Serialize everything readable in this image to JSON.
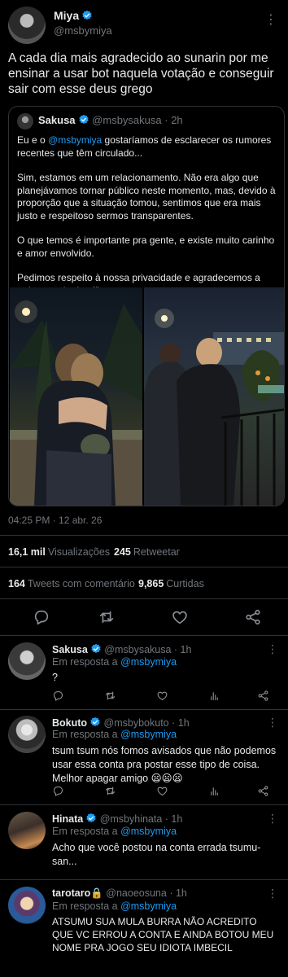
{
  "main": {
    "name": "Miya",
    "handle": "@msbymiya",
    "text": "A cada dia mais agradecido ao sunarin por me ensinar a usar bot naquela votação e conseguir sair com esse deus grego",
    "more_icon": "more-icon",
    "quote": {
      "name": "Sakusa",
      "handle": "@msbysakusa",
      "time": "· 2h",
      "p1_pre": "Eu e o ",
      "p1_mention": "@msbymiya",
      "p1_post": " gostaríamos de esclarecer os rumores recentes que têm circulado...",
      "p2": "Sim, estamos em um relacionamento. Não era algo que planejávamos tornar público neste momento, mas, devido à proporção que a situação tomou, sentimos que era mais justo e respeitoso sermos transparentes.",
      "p3": "O que temos é importante pra gente, e existe muito carinho e amor envolvido.",
      "p4": "Pedimos respeito à nossa privacidade e agradecemos a todo o apoio dos fãs."
    },
    "timestamp": "04:25 PM · 12 abr. 26",
    "views_count": "16,1 mil",
    "views_label": "Visualizações",
    "retweets_count": "245",
    "retweets_label": "Retweetar",
    "comments_count": "164",
    "comments_label": "Tweets com comentário",
    "likes_count": "9,865",
    "likes_label": "Curtidas"
  },
  "replies": [
    {
      "name": "Sakusa",
      "handle": "@msbysakusa",
      "time": "· 1h",
      "reply_to_label": "Em resposta a",
      "reply_to": "@msbymiya",
      "text": "?"
    },
    {
      "name": "Bokuto",
      "handle": "@msbybokuto",
      "time": "· 1h",
      "reply_to_label": "Em resposta a",
      "reply_to": "@msbymiya",
      "text": "tsum tsum nós fomos avisados que não podemos usar essa conta pra postar esse tipo de coisa. Melhor apagar amigo 😦😦😦"
    },
    {
      "name": "Hinata",
      "handle": "@msbyhinata",
      "time": "· 1h",
      "reply_to_label": "Em resposta a",
      "reply_to": "@msbymiya",
      "text": "Acho que você postou na conta errada tsumu-san..."
    },
    {
      "name": "tarotaro🔒",
      "handle": "@naoeosuna",
      "time": "· 1h",
      "reply_to_label": "Em resposta a",
      "reply_to": "@msbymiya",
      "text": "ATSUMU SUA MULA BURRA NÃO ACREDITO QUE VC ERROU A CONTA E AINDA BOTOU MEU NOME PRA JOGO SEU IDIOTA IMBECIL"
    }
  ],
  "colors": {
    "accent": "#1d9bf0",
    "muted": "#71767b",
    "text": "#e7e9ea",
    "divider": "#2f3336",
    "background": "#000000"
  }
}
